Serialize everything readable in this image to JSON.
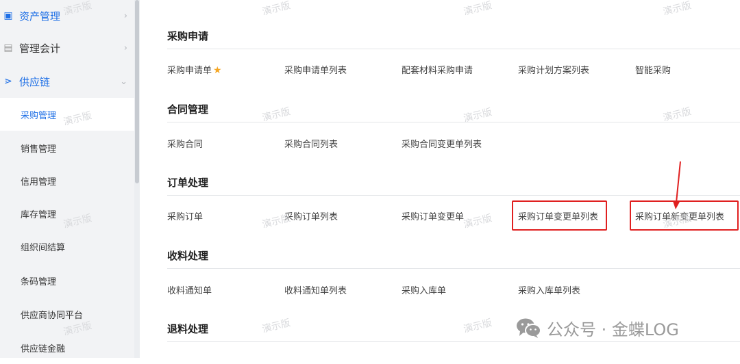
{
  "sidebar": {
    "top_items": [
      {
        "label": "资产管理",
        "icon": "asset-icon"
      },
      {
        "label": "管理会计",
        "icon": "book-icon"
      },
      {
        "label": "供应链",
        "icon": "share-icon"
      }
    ],
    "sub_items": [
      {
        "label": "采购管理"
      },
      {
        "label": "销售管理"
      },
      {
        "label": "信用管理"
      },
      {
        "label": "库存管理"
      },
      {
        "label": "组织间结算"
      },
      {
        "label": "条码管理"
      },
      {
        "label": "供应商协同平台"
      },
      {
        "label": "供应链金融"
      }
    ]
  },
  "sections": [
    {
      "title": "采购申请",
      "links": [
        "采购申请单",
        "采购申请单列表",
        "配套材料采购申请",
        "采购计划方案列表",
        "智能采购"
      ]
    },
    {
      "title": "合同管理",
      "links": [
        "采购合同",
        "采购合同列表",
        "采购合同变更单列表"
      ]
    },
    {
      "title": "订单处理",
      "links": [
        "采购订单",
        "采购订单列表",
        "采购订单变更单",
        "采购订单变更单列表",
        "采购订单新变更单列表"
      ]
    },
    {
      "title": "收料处理",
      "links": [
        "收料通知单",
        "收料通知单列表",
        "采购入库单",
        "采购入库单列表"
      ]
    },
    {
      "title": "退料处理",
      "links": []
    }
  ],
  "watermark_text": "演示版",
  "footer": {
    "text": "公众号 · 金蝶LOG"
  },
  "colors": {
    "accent": "#1e6fe6",
    "highlight": "#e02020",
    "star": "#f5a623"
  }
}
